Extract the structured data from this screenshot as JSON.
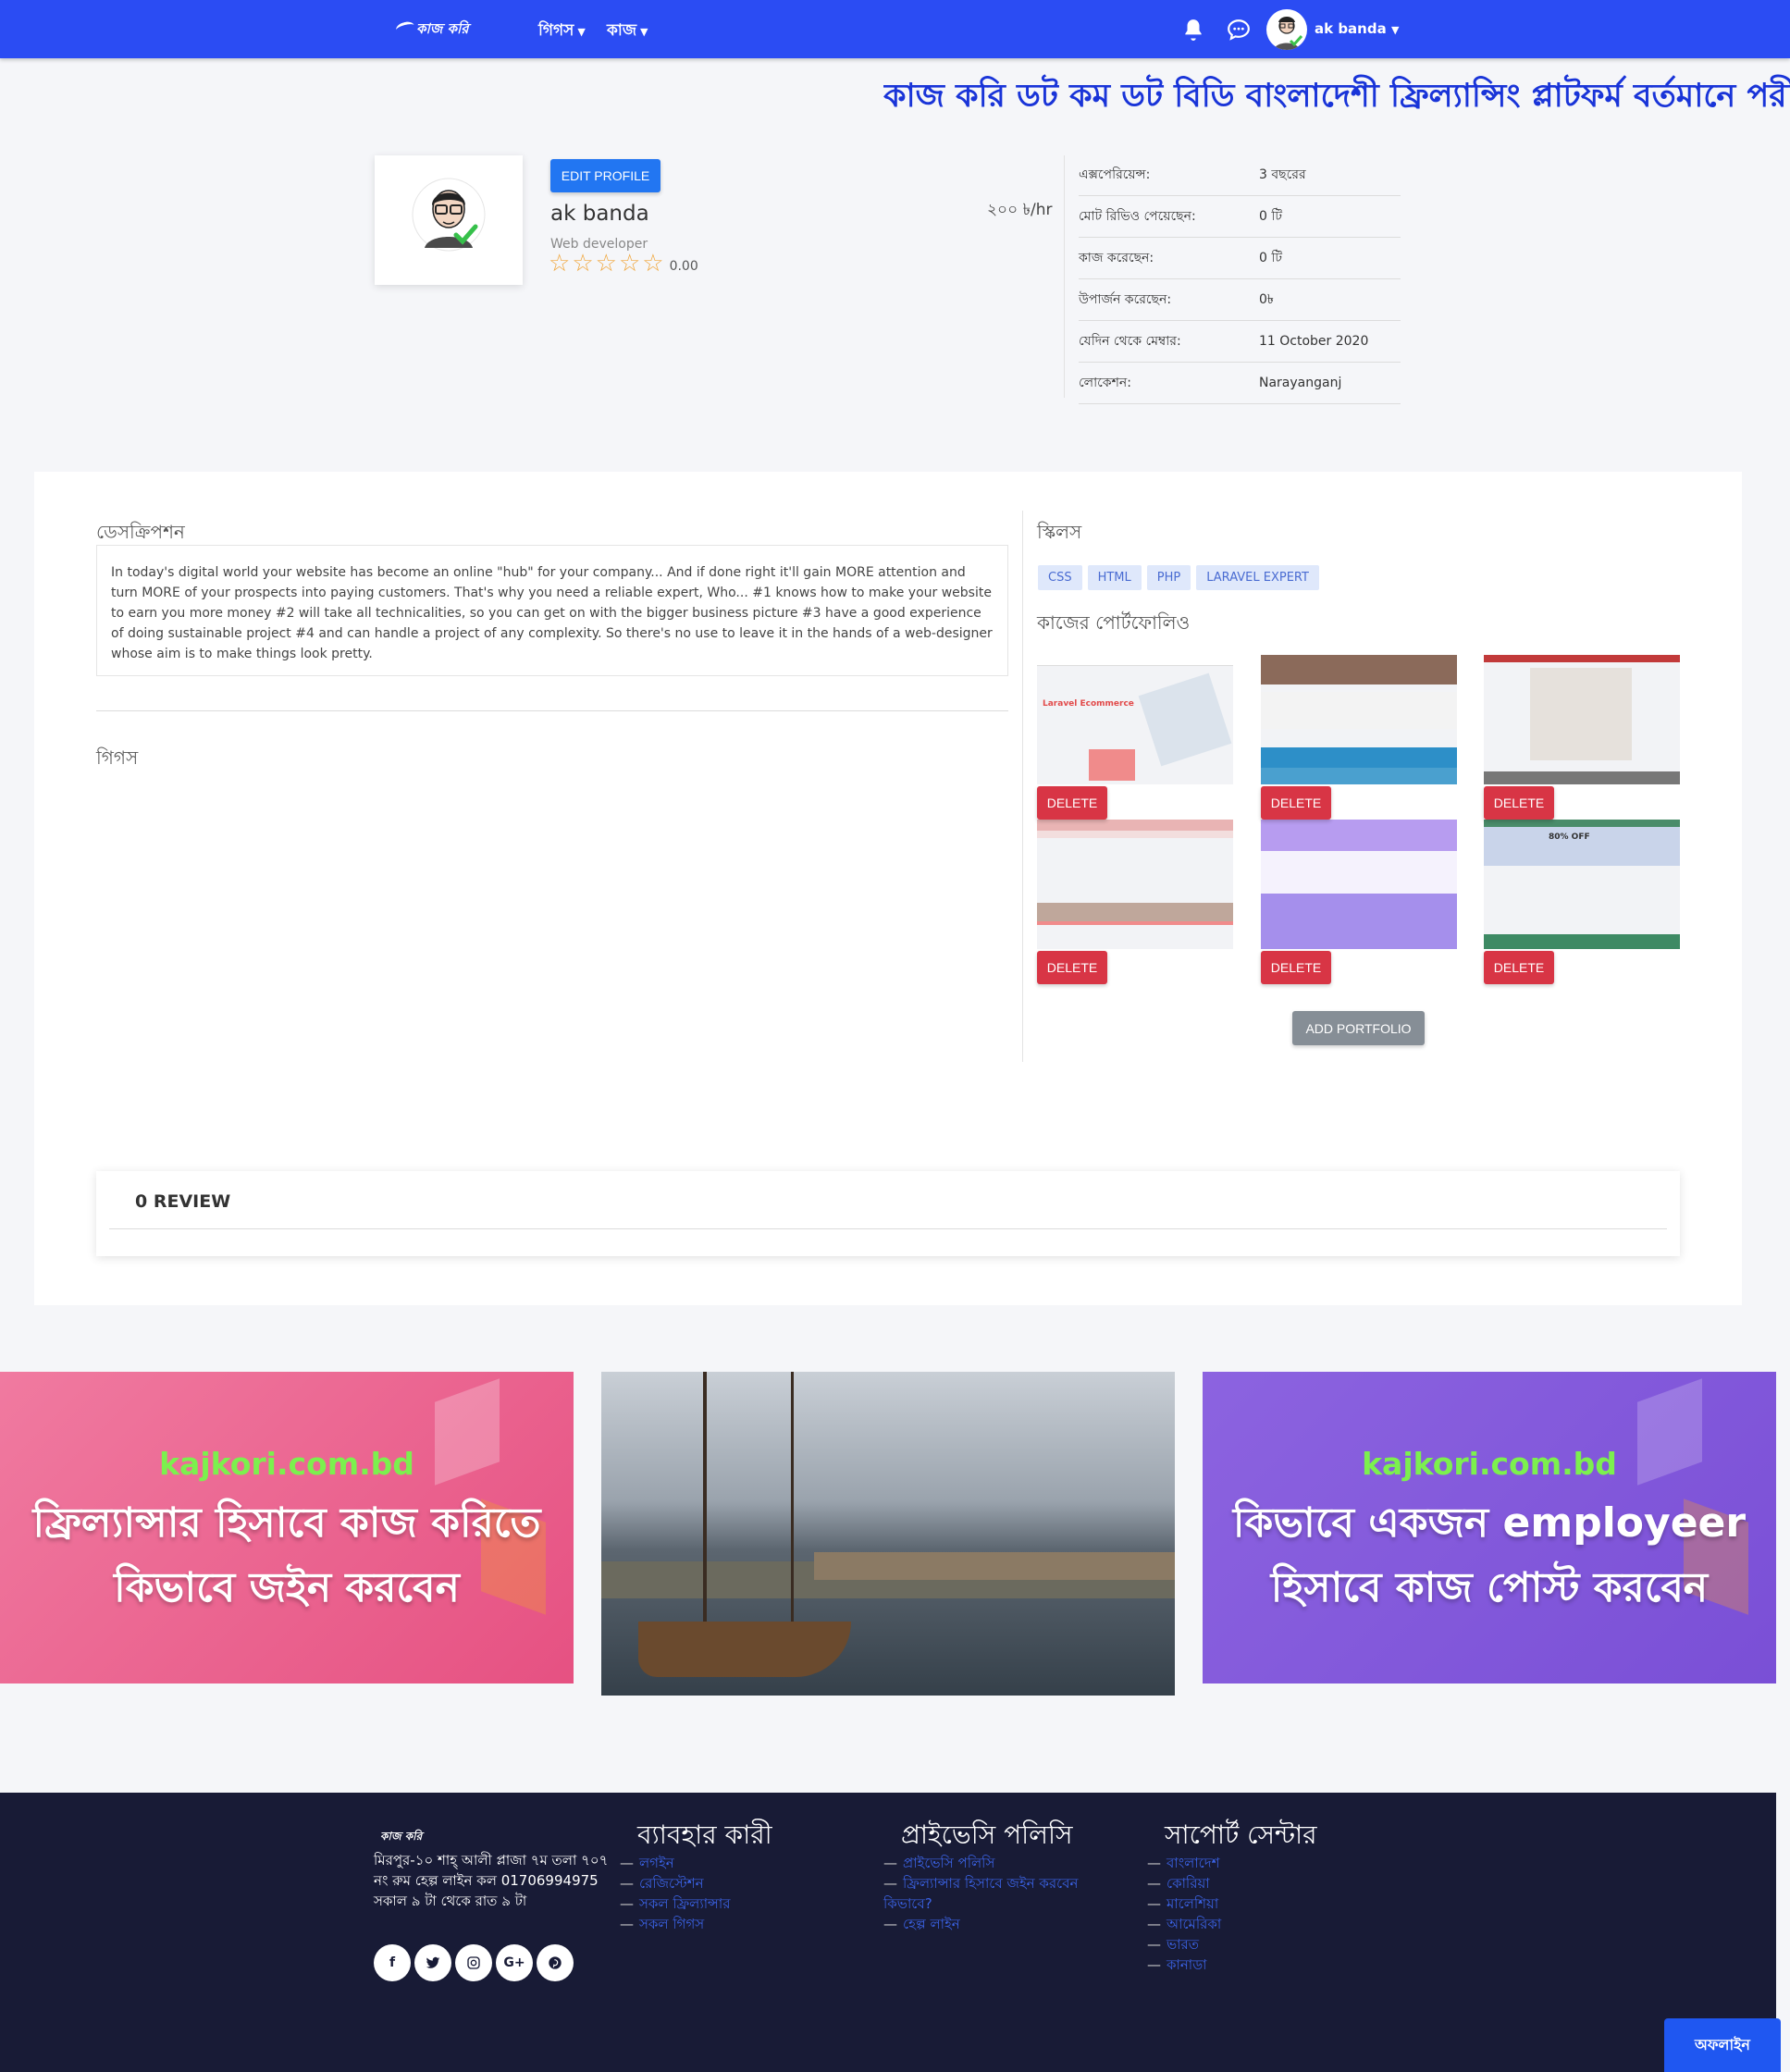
{
  "nav": {
    "logo_text": "কাজ করি",
    "menu": [
      {
        "label": "গিগস"
      },
      {
        "label": "কাজ"
      }
    ],
    "user_name": "ak banda"
  },
  "marquee": "কাজ করি ডট কম ডট বিডি বাংলাদেশী ফ্রিল্যান্সিং প্লাটফর্ম বর্তমানে পরী",
  "profile": {
    "edit_label": "EDIT PROFILE",
    "name": "ak banda",
    "title": "Web developer",
    "rating": "0.00",
    "rate": "২০০ ৳/hr",
    "stats": [
      {
        "k": "এক্সপেরিয়েন্স:",
        "v": "3 বছরের"
      },
      {
        "k": "মোট রিভিও পেয়েছেন:",
        "v": "0 টি"
      },
      {
        "k": "কাজ করেছেন:",
        "v": "0 টি"
      },
      {
        "k": "উপার্জন করেছেন:",
        "v": "0৳"
      },
      {
        "k": "যেদিন থেকে মেম্বার:",
        "v": "11 October 2020"
      },
      {
        "k": "লোকেশন:",
        "v": "Narayanganj"
      }
    ]
  },
  "main": {
    "description_heading": "ডেসক্রিপশন",
    "description": "In today's digital world your website has become an online \"hub\" for your company... And if done right it'll gain MORE attention and turn MORE of your prospects into paying customers. That's why you need a reliable expert, Who... #1 knows how to make your website to earn you more money #2 will take all technicalities, so you can get on with the bigger business picture #3 have a good experience of doing sustainable project #4 and can handle a project of any complexity. So there's no use to leave it in the hands of a web-designer whose aim is to make things look pretty.",
    "gigs_heading": "গিগস",
    "skills_heading": "স্কিলস",
    "skills": [
      "CSS",
      "HTML",
      "PHP",
      "LARAVEL EXPERT"
    ],
    "portfolio_heading": "কাজের পোর্টফোলিও",
    "delete_label": "DELETE",
    "add_portfolio_label": "ADD PORTFOLIO",
    "review_title": "0 REVIEW"
  },
  "banners": [
    {
      "site": "kajkori.com.bd",
      "line1": "ফ্রিল্যান্সার হিসাবে কাজ করিতে",
      "line2": "কিভাবে জইন করবেন"
    },
    {
      "site": "kajkori.com.bd",
      "line1": "কিভাবে একজন employeer",
      "line2": "হিসাবে কাজ পোস্ট করবেন"
    }
  ],
  "footer": {
    "logo_text": "কাজ করি",
    "address": "মিরপুর-১০ শাহ্ আলী প্লাজা ৭ম তলা ৭০৭ নং রুম হেল্প লাইন কল 01706994975 সকাল ৯ টা থেকে রাত ৯ টা",
    "col1": {
      "heading": "ব্যাবহার কারী",
      "links": [
        "লগইন",
        "রেজিস্টেশন",
        "সকল ফ্রিল্যান্সার",
        "সকল গিগস"
      ]
    },
    "col2": {
      "heading": "প্রাইভেসি পলিসি",
      "links": [
        "প্রাইভেসি পলিসি",
        "ফ্রিল্যান্সার হিসাবে জইন করবেন কিভাবে?",
        "হেল্প লাইন"
      ]
    },
    "col3": {
      "heading": "সাপোর্ট সেন্টার",
      "links": [
        "বাংলাদেশ",
        "কোরিয়া",
        "মালেশিয়া",
        "আমেরিকা",
        "ভারত",
        "কানাডা"
      ]
    }
  },
  "chat_status": "অফলাইন",
  "colors": {
    "nav": "#2b4cf3",
    "primary": "#2276f2",
    "danger": "#d83545",
    "secondary": "#868e96",
    "footer": "#181b36",
    "link": "#3b63e6"
  },
  "icons": [
    "bell-icon",
    "chat-icon",
    "star-icon",
    "facebook-icon",
    "twitter-icon",
    "instagram-icon",
    "google-plus-icon",
    "pinterest-icon"
  ]
}
